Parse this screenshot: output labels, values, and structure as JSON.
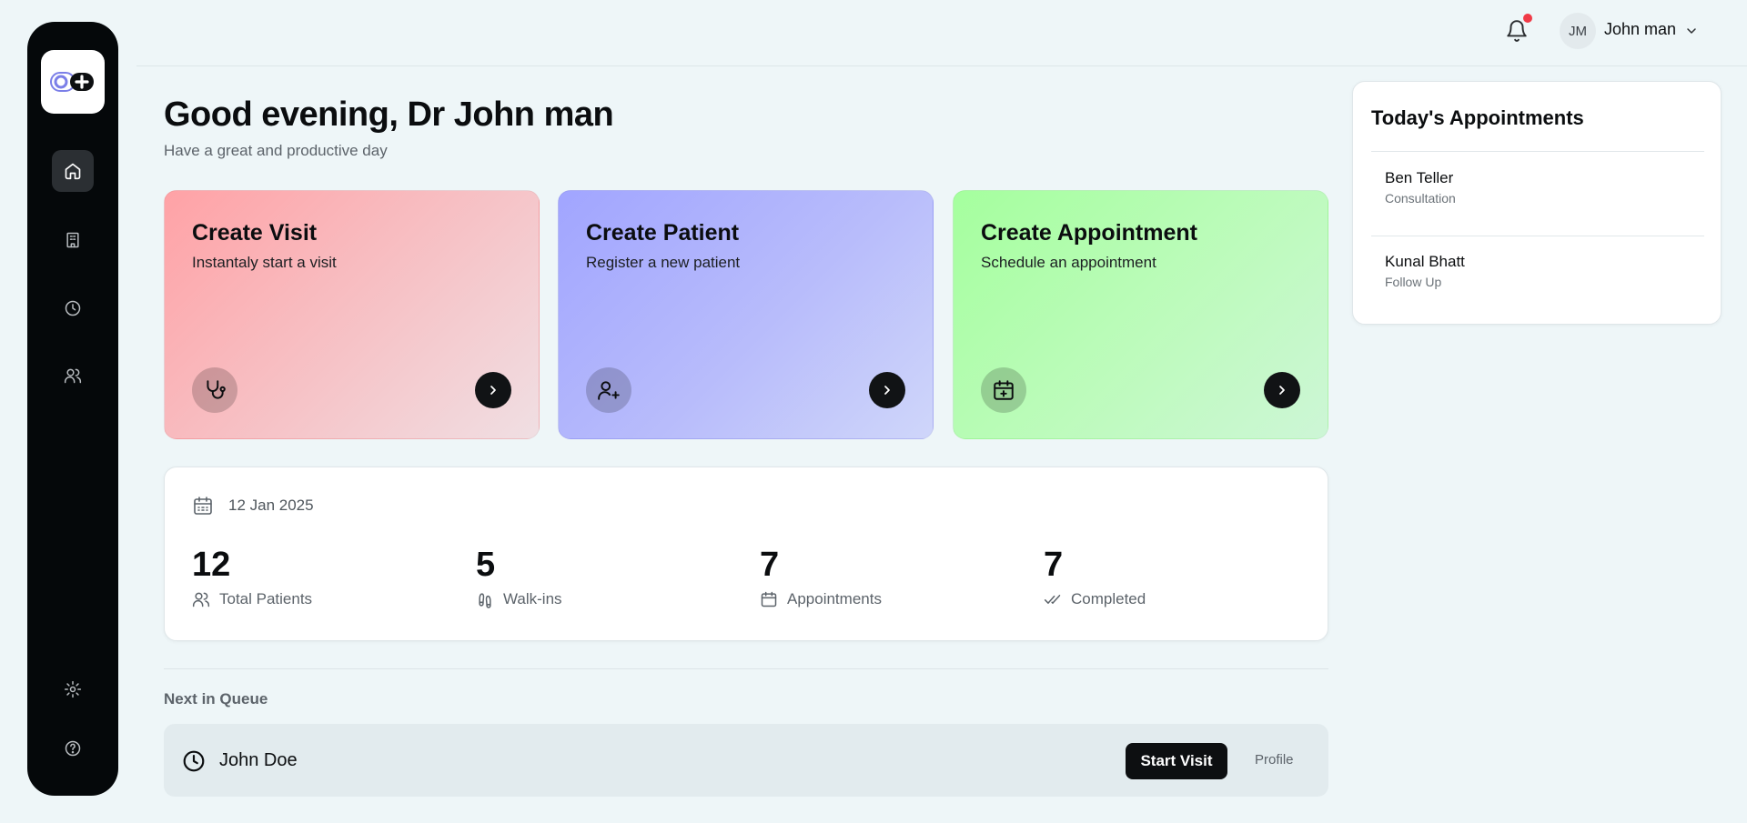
{
  "user": {
    "initials": "JM",
    "name": "John man"
  },
  "greeting": {
    "title": "Good evening, Dr John man",
    "subtitle": "Have a great and productive day"
  },
  "sidebar": {
    "logo_icon": "clinic-logo",
    "nav": [
      {
        "name": "home",
        "icon": "home-icon",
        "active": true
      },
      {
        "name": "clinic",
        "icon": "building-icon",
        "active": false
      },
      {
        "name": "history",
        "icon": "clock-icon",
        "active": false
      },
      {
        "name": "patients",
        "icon": "users-icon",
        "active": false
      }
    ],
    "bottom": [
      {
        "name": "settings",
        "icon": "gear-icon"
      },
      {
        "name": "help",
        "icon": "help-icon"
      }
    ]
  },
  "cards": [
    {
      "title": "Create Visit",
      "subtitle": "Instantaly start a visit",
      "icon": "stethoscope-icon",
      "color": "#ffa2a6"
    },
    {
      "title": "Create Patient",
      "subtitle": "Register a new patient",
      "icon": "user-plus-icon",
      "color": "#a1a5ff"
    },
    {
      "title": "Create Appointment",
      "subtitle": "Schedule an appointment",
      "icon": "calendar-plus-icon",
      "color": "#a5ff9e"
    }
  ],
  "stats": {
    "date": "12 Jan 2025",
    "items": [
      {
        "value": "12",
        "label": "Total Patients",
        "icon": "users-icon"
      },
      {
        "value": "5",
        "label": "Walk-ins",
        "icon": "footprints-icon"
      },
      {
        "value": "7",
        "label": "Appointments",
        "icon": "calendar-icon"
      },
      {
        "value": "7",
        "label": "Completed",
        "icon": "double-check-icon"
      }
    ]
  },
  "queue": {
    "title": "Next in Queue",
    "patient": "John Doe",
    "start_label": "Start Visit",
    "profile_label": "Profile"
  },
  "appointments": {
    "title": "Today's Appointments",
    "items": [
      {
        "name": "Ben Teller",
        "type": "Consultation"
      },
      {
        "name": "Kunal Bhatt",
        "type": "Follow Up"
      }
    ]
  },
  "colors": {
    "sidebar": "#05080a",
    "accent_dark": "#0d0f11",
    "notification_dot": "#f03a47",
    "background": "#eef6f8"
  }
}
